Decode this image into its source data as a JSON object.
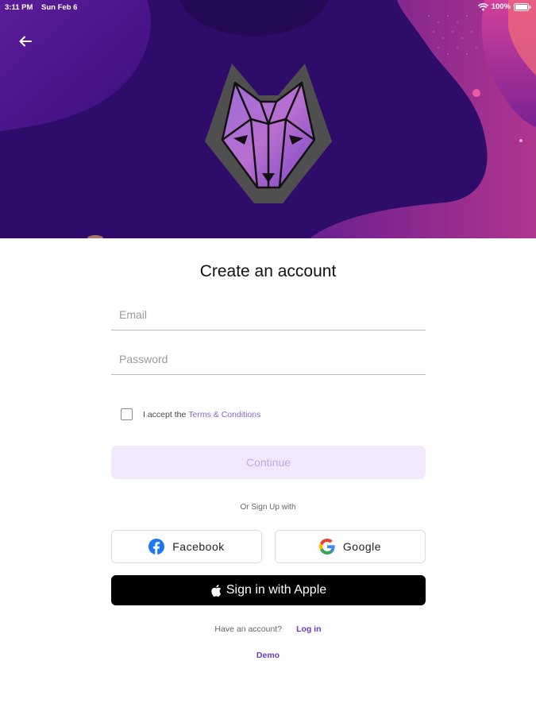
{
  "status_bar": {
    "time": "3:11 PM",
    "date": "Sun Feb 6",
    "battery": "100%"
  },
  "icons": {
    "back": "back-arrow-icon",
    "wifi": "wifi-icon",
    "battery": "battery-icon",
    "logo": "wolf-logo-icon",
    "facebook": "facebook-icon",
    "google": "google-icon",
    "apple": "apple-icon"
  },
  "header": {
    "title": "Create an account"
  },
  "form": {
    "email_placeholder": "Email",
    "password_placeholder": "Password",
    "terms_prefix": "I accept the",
    "terms_link": "Terms & Conditions",
    "continue_label": "Continue",
    "or_text": "Or Sign Up with"
  },
  "social": {
    "facebook_label": "Facebook",
    "google_label": "Google",
    "apple_label": "Sign in with Apple"
  },
  "footer": {
    "have_account": "Have an account?",
    "login_label": "Log in",
    "demo_label": "Demo"
  },
  "colors": {
    "accent": "#6b3bbf",
    "hero_bg": "#2e0c69",
    "continue_bg": "#f1e9fb",
    "continue_text": "#c2a6ea",
    "apple_bg": "#000000"
  }
}
